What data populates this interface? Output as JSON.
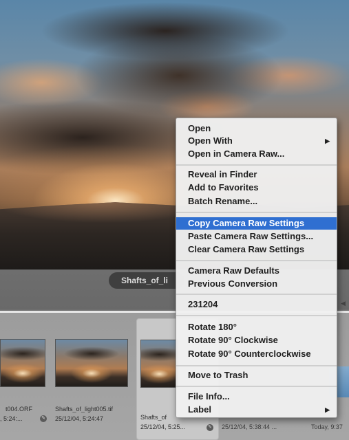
{
  "preview": {
    "filename": "Shafts_of_li"
  },
  "context_menu": {
    "items": [
      {
        "label": "Open"
      },
      {
        "label": "Open With",
        "submenu": true
      },
      {
        "label": "Open in Camera Raw..."
      },
      {
        "label": "Reveal in Finder"
      },
      {
        "label": "Add to Favorites"
      },
      {
        "label": "Batch Rename..."
      },
      {
        "label": "Copy Camera Raw Settings",
        "highlighted": true
      },
      {
        "label": "Paste Camera Raw Settings..."
      },
      {
        "label": "Clear Camera Raw Settings"
      },
      {
        "label": "Camera Raw Defaults"
      },
      {
        "label": "Previous Conversion"
      },
      {
        "label": "231204"
      },
      {
        "label": "Rotate 180°"
      },
      {
        "label": "Rotate 90° Clockwise"
      },
      {
        "label": "Rotate 90° Counterclockwise"
      },
      {
        "label": "Move to Trash"
      },
      {
        "label": "File Info..."
      },
      {
        "label": "Label",
        "submenu": true
      }
    ],
    "highlight_color": "#2f6fd1"
  },
  "filmstrip": {
    "thumbnails": [
      {
        "name": "t004.ORF",
        "date": ", 5:24:..."
      },
      {
        "name": "Shafts_of_light005.tif",
        "date": "25/12/04, 5:24:47"
      },
      {
        "name": "Shafts_of",
        "date": "25/12/04, 5:25...",
        "selected": true
      },
      {
        "name": "",
        "date": "25/12/04, 5:38:44 ..."
      },
      {
        "name": "",
        "date": "Today, 9:37"
      }
    ]
  }
}
